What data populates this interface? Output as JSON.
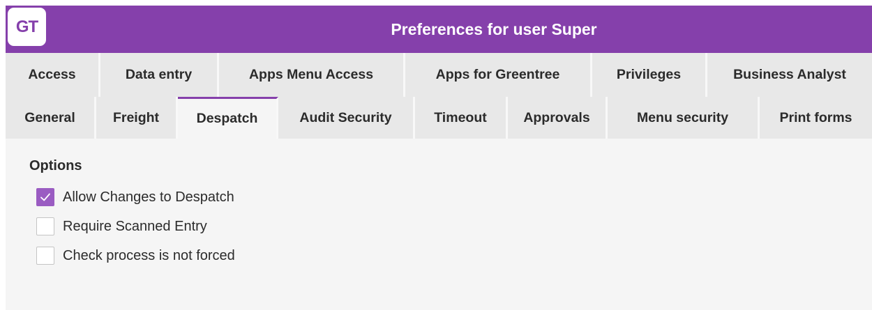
{
  "window": {
    "logo_text": "GT",
    "title": "Preferences for user Super",
    "accent_color": "#8540ab"
  },
  "tabs": {
    "row1": [
      {
        "label": "Access"
      },
      {
        "label": "Data entry"
      },
      {
        "label": "Apps Menu Access"
      },
      {
        "label": "Apps for Greentree"
      },
      {
        "label": "Privileges"
      },
      {
        "label": "Business Analyst"
      }
    ],
    "row2": [
      {
        "label": "General"
      },
      {
        "label": "Freight"
      },
      {
        "label": "Despatch",
        "active": true
      },
      {
        "label": "Audit Security"
      },
      {
        "label": "Timeout"
      },
      {
        "label": "Approvals"
      },
      {
        "label": "Menu security"
      },
      {
        "label": "Print forms"
      }
    ]
  },
  "options": {
    "title": "Options",
    "items": [
      {
        "label": "Allow Changes to Despatch",
        "checked": true
      },
      {
        "label": "Require Scanned Entry",
        "checked": false
      },
      {
        "label": "Check process is not forced",
        "checked": false
      }
    ]
  }
}
